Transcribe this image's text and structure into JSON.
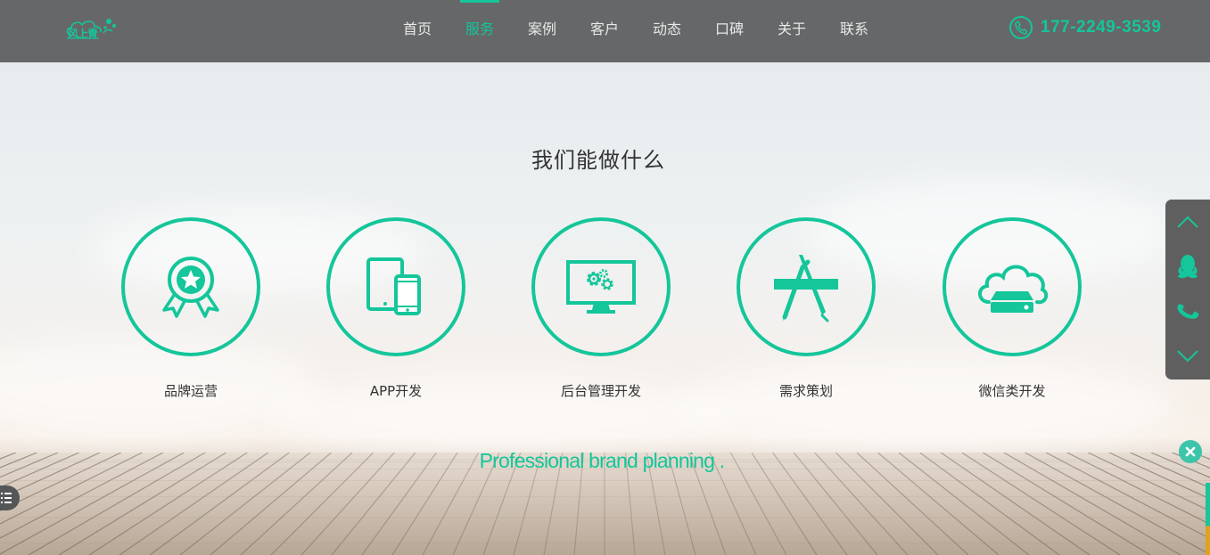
{
  "header": {
    "logo_text": "风上青",
    "nav": [
      {
        "label": "首页",
        "active": false
      },
      {
        "label": "服务",
        "active": true
      },
      {
        "label": "案例",
        "active": false
      },
      {
        "label": "客户",
        "active": false
      },
      {
        "label": "动态",
        "active": false
      },
      {
        "label": "口碑",
        "active": false
      },
      {
        "label": "关于",
        "active": false
      },
      {
        "label": "联系",
        "active": false
      }
    ],
    "phone": "177-2249-3539"
  },
  "section": {
    "title": "我们能做什么",
    "services": [
      {
        "label": "品牌运营",
        "icon": "award-badge-icon"
      },
      {
        "label": "APP开发",
        "icon": "tablet-phone-icon"
      },
      {
        "label": "后台管理开发",
        "icon": "monitor-gears-icon"
      },
      {
        "label": "需求策划",
        "icon": "app-store-icon"
      },
      {
        "label": "微信类开发",
        "icon": "cloud-server-icon"
      }
    ],
    "tagline": "Professional brand planning ."
  },
  "sidebar": {
    "icons": [
      "chevron-up-icon",
      "qq-icon",
      "phone-icon",
      "chevron-down-icon"
    ]
  },
  "colors": {
    "accent": "#14c69a",
    "header_bg": "#666768",
    "sidebar_bg": "#5f5f60"
  }
}
